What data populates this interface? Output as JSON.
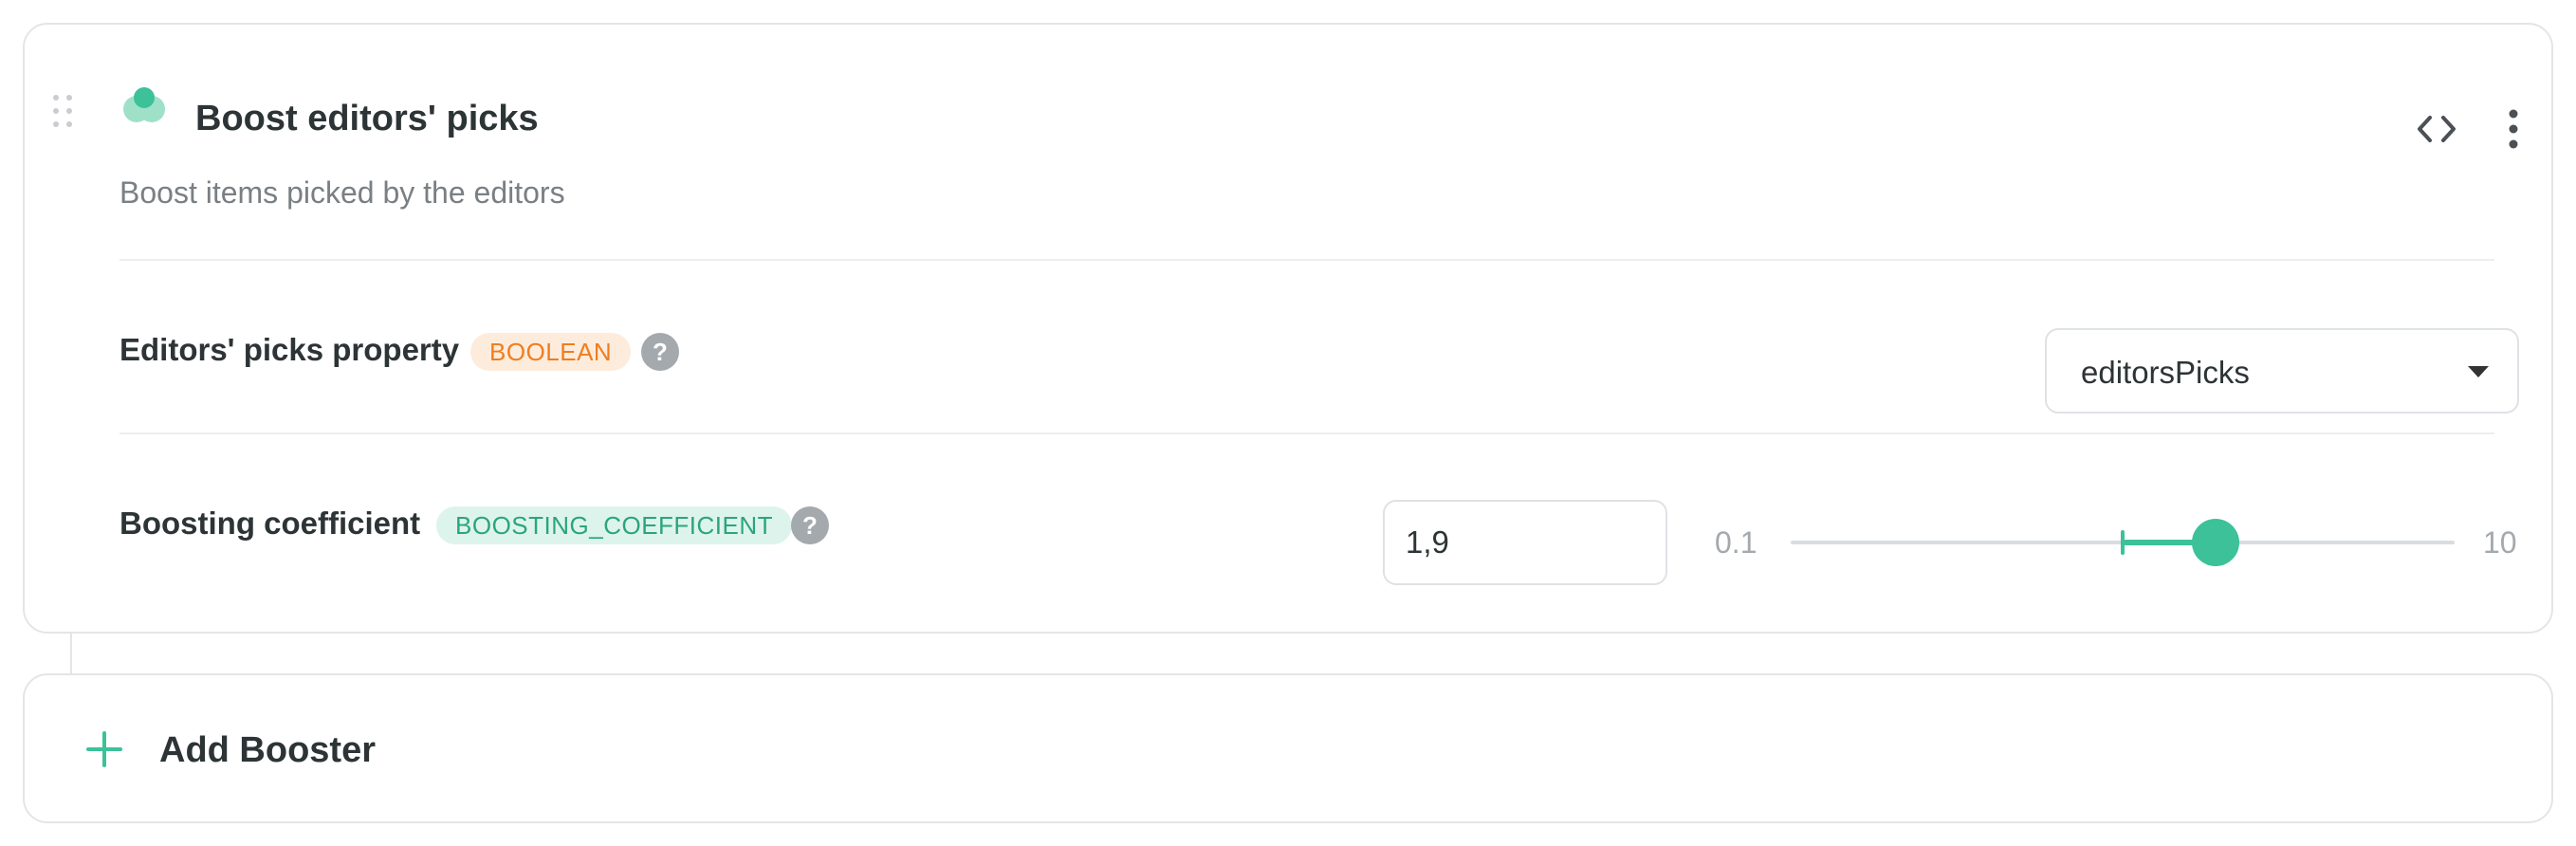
{
  "booster": {
    "title": "Boost editors' picks",
    "description": "Boost items picked by the editors",
    "icon": "booster-drops-icon",
    "accent_color": "#3cc199"
  },
  "fields": {
    "editors_picks": {
      "label": "Editors' picks property",
      "type_badge": "BOOLEAN",
      "selected_value": "editorsPicks"
    },
    "coefficient": {
      "label": "Boosting coefficient",
      "type_badge": "BOOSTING_COEFFICIENT",
      "value": "1,9",
      "min_label": "0.1",
      "max_label": "10",
      "min": 0.1,
      "max": 10,
      "current": 1.9,
      "default": 1.0
    }
  },
  "add": {
    "label": "Add Booster"
  }
}
